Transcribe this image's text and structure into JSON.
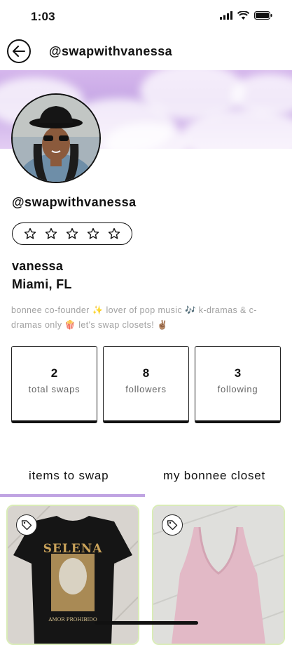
{
  "status_bar": {
    "time": "1:03",
    "icons": [
      "signal-icon",
      "wifi-icon",
      "battery-icon"
    ]
  },
  "header": {
    "title": "@swapwithvanessa",
    "back_icon": "arrow-left-icon"
  },
  "profile": {
    "handle": "@swapwithvanessa",
    "rating": {
      "stars": 5,
      "filled": 0
    },
    "name": "vanessa",
    "location": "Miami, FL",
    "bio": "bonnee co-founder ✨ lover of pop music 🎶 k-dramas & c-dramas only 🍿 let's swap closets! ✌🏽"
  },
  "stats": [
    {
      "value": "2",
      "label": "total swaps"
    },
    {
      "value": "8",
      "label": "followers"
    },
    {
      "value": "3",
      "label": "following"
    }
  ],
  "tabs": [
    {
      "label": "items to swap",
      "active": true
    },
    {
      "label": "my bonnee closet",
      "active": false
    }
  ],
  "items": [
    {
      "icon": "tag-icon",
      "print_text_1": "SELENA",
      "print_text_2": "AMOR PROHIBIDO"
    },
    {
      "icon": "tag-icon"
    }
  ],
  "colors": {
    "accent": "#bfa3e2",
    "card_border": "#d9ecb7",
    "bio_text": "#a2a2a2"
  }
}
